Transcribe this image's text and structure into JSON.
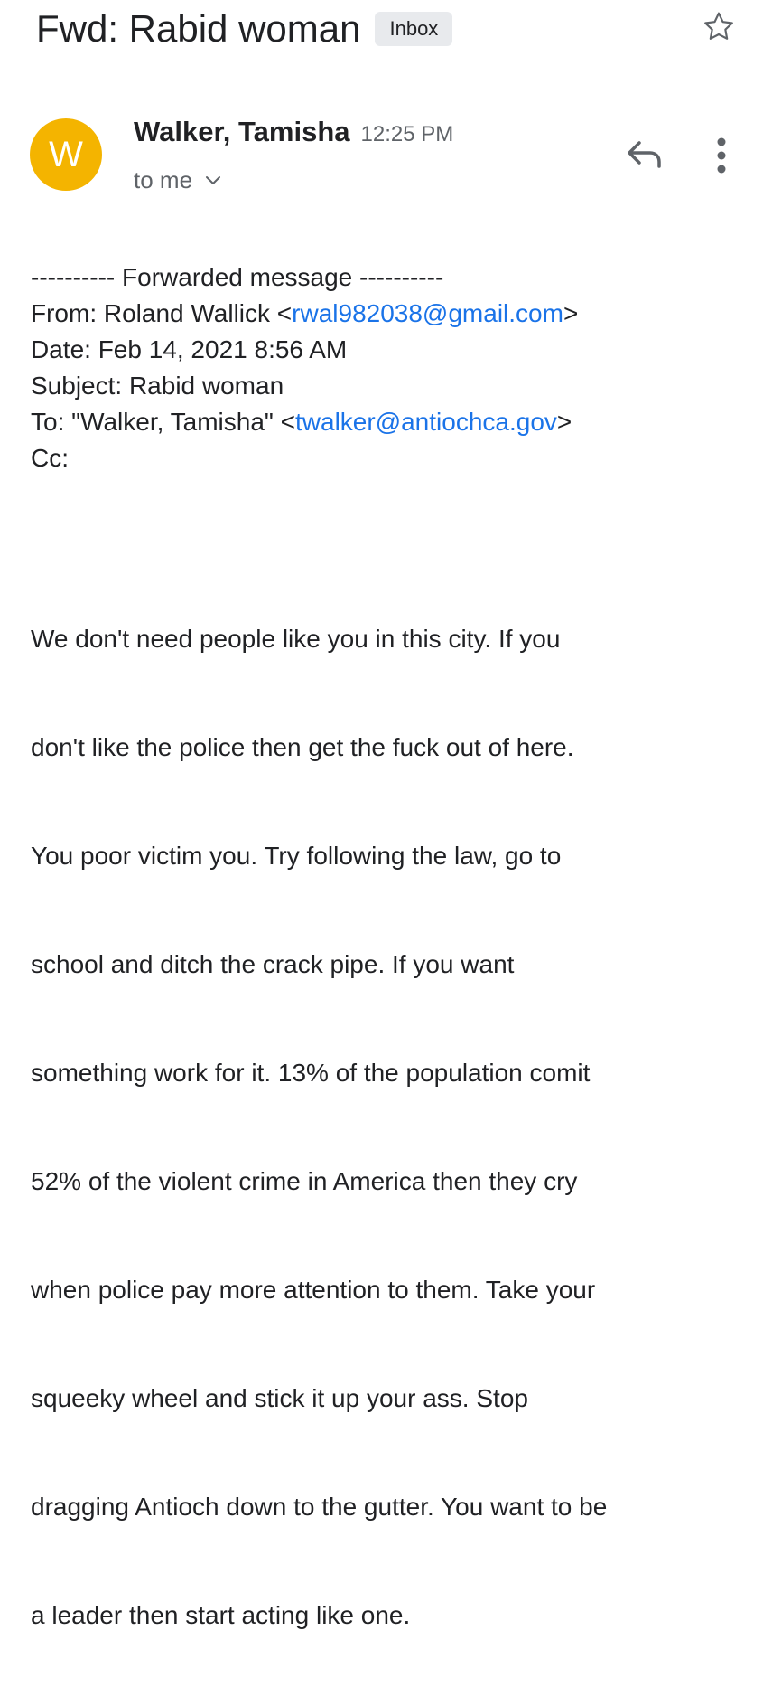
{
  "header": {
    "subject": "Fwd: Rabid woman",
    "label": "Inbox",
    "star_icon": "star-outline-icon"
  },
  "sender": {
    "avatar_letter": "W",
    "avatar_color": "#f4b400",
    "name": "Walker, Tamisha",
    "time": "12:25 PM",
    "recipient": "to me"
  },
  "actions": {
    "reply_icon": "reply-icon",
    "more_icon": "more-vertical-icon"
  },
  "forwarded": {
    "separator": "---------- Forwarded message ----------",
    "from_label": "From: Roland Wallick <",
    "from_email": "rwal982038@gmail.com",
    "from_suffix": ">",
    "date": "Date: Feb 14, 2021 8:56 AM",
    "subject": "Subject: Rabid woman",
    "to_label": "To: \"Walker, Tamisha\" <",
    "to_email": "twalker@antiochca.gov",
    "to_suffix": ">",
    "cc": "Cc:"
  },
  "message": {
    "lines": [
      "We don't need people like you in this city. If you",
      "don't like the police then get the fuck out of here.",
      "You poor victim you. Try following the law, go to",
      "school and ditch the crack pipe.  If you want",
      "something work for it. 13% of the population comit",
      "52% of the violent crime in America then they cry",
      "when police pay more attention to them. Take your",
      "squeeky wheel and stick it up your ass. Stop",
      "dragging Antioch down to the gutter. You want to be",
      "a leader then start acting like one."
    ]
  },
  "colors": {
    "link": "#1a73e8",
    "secondary_text": "#5f6368",
    "badge_bg": "#e8eaed"
  }
}
